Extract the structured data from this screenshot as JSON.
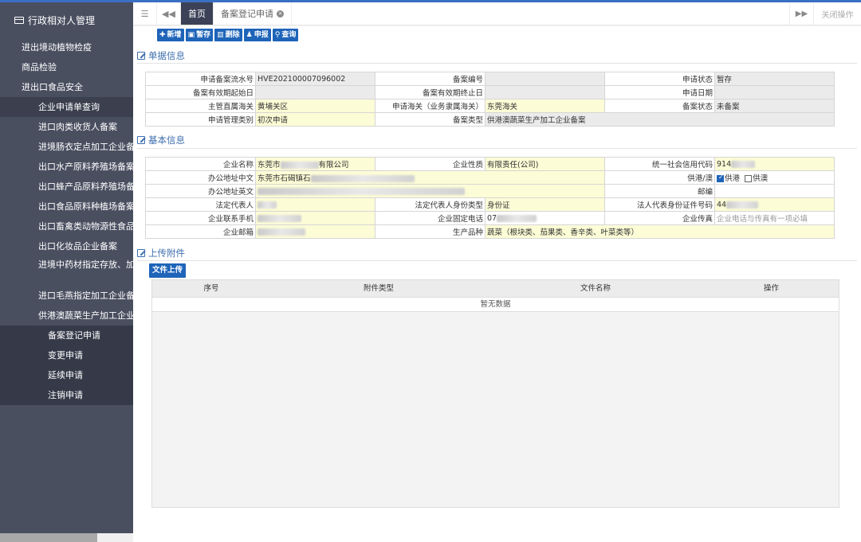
{
  "sidebar": {
    "title": "行政相对人管理",
    "level1": [
      "进出境动植物检疫",
      "商品检验",
      "进出口食品安全"
    ],
    "level2": [
      "企业申请单查询",
      "进口肉类收货人备案",
      "进境肠衣定点加工企业备案",
      "出口水产原料养殖场备案",
      "出口蜂产品原料养殖场备案",
      "出口食品原料种植场备案",
      "出口畜禽类动物源性食品",
      "出口化妆品企业备案",
      "进境中药材指定存放、加",
      "进口毛燕指定加工企业备案",
      "供港澳蔬菜生产加工企业备"
    ],
    "level3": [
      "备案登记申请",
      "变更申请",
      "延续申请",
      "注销申请"
    ]
  },
  "tabs": {
    "home": "首页",
    "active": "备案登记申请",
    "close_ops": "关闭操作"
  },
  "toolbar": {
    "new": "新增",
    "save": "暂存",
    "delete": "删除",
    "declare": "申报",
    "query": "查询"
  },
  "sections": {
    "doc_info": "单据信息",
    "basic_info": "基本信息",
    "attachments": "上传附件"
  },
  "doc_form": {
    "serial_label": "申请备案流水号",
    "serial_value": "HVE202100007096002",
    "record_no_label": "备案编号",
    "record_no_value": "",
    "status_label": "申请状态",
    "status_value": "暂存",
    "valid_start_label": "备案有效期起始日",
    "valid_start_value": "",
    "valid_end_label": "备案有效期终止日",
    "valid_end_value": "",
    "apply_date_label": "申请日期",
    "apply_date_value": "",
    "customs_label": "主管直属海关",
    "customs_value": "黄埔关区",
    "apply_customs_label": "申请海关（业务隶属海关）",
    "apply_customs_value": "东莞海关",
    "record_status_label": "备案状态",
    "record_status_value": "未备案",
    "manage_type_label": "申请管理类别",
    "manage_type_value": "初次申请",
    "record_type_label": "备案类型",
    "record_type_value": "供港澳蔬菜生产加工企业备案"
  },
  "basic_form": {
    "company_name_label": "企业名称",
    "company_name_prefix": "东莞市",
    "company_name_suffix": "有限公司",
    "nature_label": "企业性质",
    "nature_value": "有限责任(公司)",
    "credit_code_label": "统一社会信用代码",
    "credit_code_value": "914",
    "addr_cn_label": "办公地址中文",
    "addr_cn_value": "东莞市石碣镇石",
    "supply_label": "供港/澳",
    "supply_hk": "供港",
    "supply_mo": "供澳",
    "addr_en_label": "办公地址英文",
    "zip_label": "邮编",
    "legal_rep_label": "法定代表人",
    "id_type_label": "法定代表人身份类型",
    "id_type_value": "身份证",
    "id_no_label": "法人代表身份证件号码",
    "id_no_value": "44",
    "mobile_label": "企业联系手机",
    "phone_label": "企业固定电话",
    "phone_value": "07",
    "fax_label": "企业传真",
    "fax_placeholder": "企业电话与传真有一项必填",
    "email_label": "企业邮箱",
    "product_label": "生产品种",
    "product_value": "蔬菜（根块类、茄果类、香辛类、叶菜类等）"
  },
  "attachments": {
    "upload_button": "文件上传",
    "columns": [
      "序号",
      "附件类型",
      "文件名称",
      "操作"
    ],
    "empty_text": "暂无数据"
  }
}
